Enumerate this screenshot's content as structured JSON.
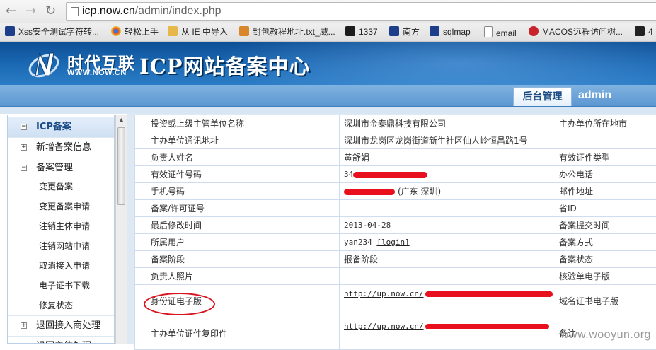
{
  "browser": {
    "url_host": "icp.now.cn",
    "url_path": "/admin/index.php",
    "bookmarks": [
      {
        "label": "Xss安全测试字符转...",
        "icon": "paw-icon",
        "color": "#1d3e8a"
      },
      {
        "label": "轻松上手",
        "icon": "chrome-icon",
        "color": "#e24a2d"
      },
      {
        "label": "从 IE 中导入",
        "icon": "folder-icon",
        "color": "#e6b84a"
      },
      {
        "label": "封包教程地址.txt_威...",
        "icon": "site-icon",
        "color": "#d9862a"
      },
      {
        "label": "1337",
        "icon": "site-icon",
        "color": "#1c1c1c"
      },
      {
        "label": "南方",
        "icon": "paw-icon",
        "color": "#1d3e8a"
      },
      {
        "label": "sqlmap",
        "icon": "paw-icon",
        "color": "#1d3e8a"
      },
      {
        "label": "email",
        "icon": "page-icon",
        "color": "#ffffff"
      },
      {
        "label": "MACOS远程访问树...",
        "icon": "site-icon",
        "color": "#c9232b"
      },
      {
        "label": "4",
        "icon": "site-icon",
        "color": "#222222"
      }
    ]
  },
  "header": {
    "logo_cn": "时代互联",
    "logo_en": "WWW.NOW.CN",
    "title": "ICP网站备案中心",
    "tab": "后台管理",
    "user": "admin"
  },
  "sidebar": {
    "sections": [
      {
        "label": "ICP备案",
        "marker": "−"
      },
      {
        "label": "新增备案信息",
        "marker": "+"
      },
      {
        "label": "备案管理",
        "marker": "−"
      },
      {
        "label": "退回接入商处理",
        "marker": "+"
      },
      {
        "label": "退回主体处理",
        "marker": "+"
      }
    ],
    "sub_items": [
      "变更备案",
      "变更备案申请",
      "注销主体申请",
      "注销网站申请",
      "取消接入申请",
      "电子证书下载",
      "修复状态"
    ]
  },
  "table": {
    "rows": [
      {
        "label": "投资或上级主管单位名称",
        "value": "深圳市金泰鼎科技有限公司",
        "right": "主办单位所在地市"
      },
      {
        "label": "主办单位通讯地址",
        "value": "深圳市龙岗区龙岗街道新生社区仙人岭恒昌路1号",
        "right": ""
      },
      {
        "label": "负责人姓名",
        "value": "黄舒娟",
        "right": "有效证件类型"
      },
      {
        "label": "有效证件号码",
        "value": "34",
        "right": "办公电话"
      },
      {
        "label": "手机号码",
        "value": "(广东 深圳)",
        "right": "邮件地址"
      },
      {
        "label": "备案/许可证号",
        "value": "",
        "right": "省ID"
      },
      {
        "label": "最后修改时间",
        "value": "2013-04-28",
        "right": "备案提交时间"
      },
      {
        "label": "所属用户",
        "value": "yan234",
        "value_link": "[login]",
        "right": "备案方式"
      },
      {
        "label": "备案阶段",
        "value": "报备阶段",
        "right": "备案状态"
      },
      {
        "label": "负责人照片",
        "value": "",
        "right": "核验单电子版"
      },
      {
        "label": "身份证电子版",
        "value": "http://up.now.cn/",
        "right": "域名证书电子版"
      },
      {
        "label": "主办单位证件复印件",
        "value": "http://up.now.cn/",
        "right": "备注"
      }
    ]
  },
  "watermark": "www.wooyun.org"
}
